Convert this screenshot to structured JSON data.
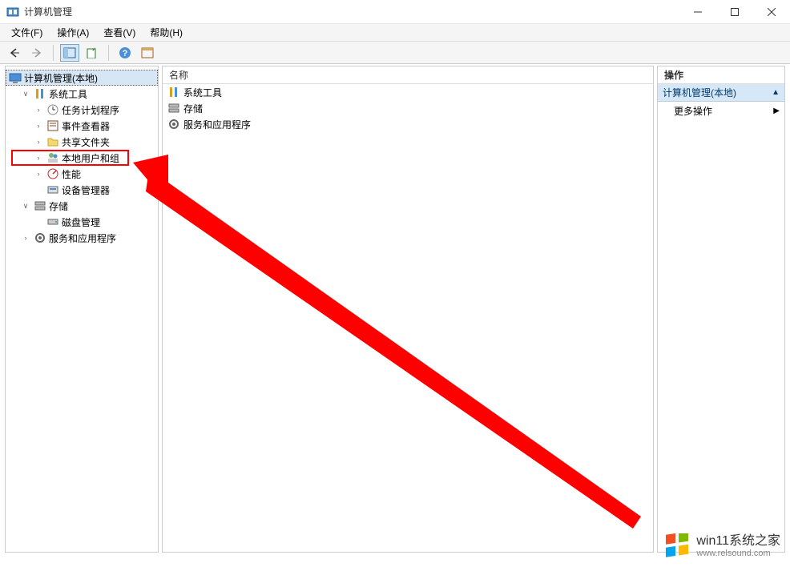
{
  "window": {
    "title": "计算机管理"
  },
  "menu": {
    "file": "文件(F)",
    "action": "操作(A)",
    "view": "查看(V)",
    "help": "帮助(H)"
  },
  "tree": {
    "root": "计算机管理(本地)",
    "system_tools": "系统工具",
    "task_scheduler": "任务计划程序",
    "event_viewer": "事件查看器",
    "shared_folders": "共享文件夹",
    "local_users": "本地用户和组",
    "performance": "性能",
    "device_manager": "设备管理器",
    "storage": "存储",
    "disk_mgmt": "磁盘管理",
    "services_apps": "服务和应用程序"
  },
  "list": {
    "header_name": "名称",
    "items": [
      "系统工具",
      "存储",
      "服务和应用程序"
    ]
  },
  "actions": {
    "header": "操作",
    "group": "计算机管理(本地)",
    "more": "更多操作"
  },
  "watermark": {
    "title": "win11系统之家",
    "url": "www.relsound.com"
  }
}
